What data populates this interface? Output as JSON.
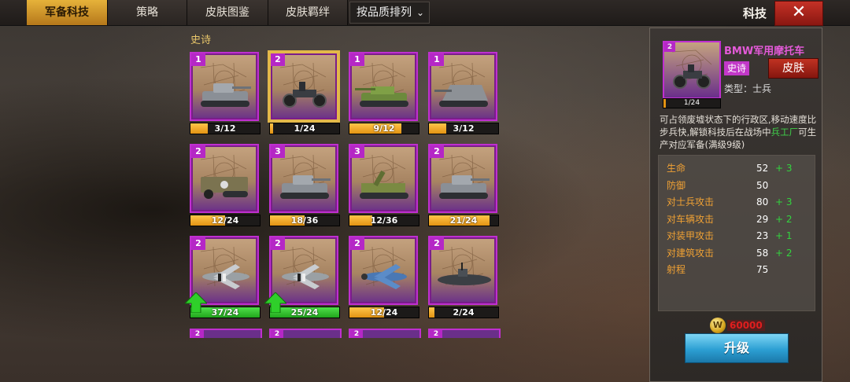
{
  "tabs": [
    {
      "label": "军备科技",
      "active": true
    },
    {
      "label": "策略",
      "active": false
    },
    {
      "label": "皮肤图鉴",
      "active": false
    },
    {
      "label": "皮肤羁绊",
      "active": false
    }
  ],
  "sort": {
    "label": "按品质排列"
  },
  "page_title": "科技",
  "section_label": "史诗",
  "cards": [
    {
      "level": "1",
      "progress": "3/12",
      "fill": 0.25,
      "unit": "tank"
    },
    {
      "level": "2",
      "progress": "1/24",
      "fill": 0.04,
      "unit": "motorcycle",
      "selected": true
    },
    {
      "level": "1",
      "progress": "9/12",
      "fill": 0.75,
      "unit": "tank-destroyer"
    },
    {
      "level": "1",
      "progress": "3/12",
      "fill": 0.25,
      "unit": "assault-gun"
    },
    {
      "level": "2",
      "progress": "12/24",
      "fill": 0.5,
      "unit": "halftrack"
    },
    {
      "level": "3",
      "progress": "18/36",
      "fill": 0.5,
      "unit": "tank"
    },
    {
      "level": "3",
      "progress": "12/36",
      "fill": 0.33,
      "unit": "artillery"
    },
    {
      "level": "2",
      "progress": "21/24",
      "fill": 0.875,
      "unit": "tank"
    },
    {
      "level": "2",
      "progress": "37/24",
      "fill": 1,
      "unit": "plane",
      "upgrade": true
    },
    {
      "level": "2",
      "progress": "25/24",
      "fill": 1,
      "unit": "plane",
      "upgrade": true
    },
    {
      "level": "2",
      "progress": "12/24",
      "fill": 0.5,
      "unit": "blue-plane"
    },
    {
      "level": "2",
      "progress": "2/24",
      "fill": 0.08,
      "unit": "submarine"
    }
  ],
  "partial_cards": [
    {
      "level": "2"
    },
    {
      "level": "2"
    },
    {
      "level": "2"
    },
    {
      "level": "2"
    }
  ],
  "detail": {
    "level": "2",
    "name": "BMW军用摩托车",
    "rarity": "史诗",
    "skin_button": "皮肤",
    "type": "类型：士兵",
    "progress": "1/24",
    "desc_before": "可占领废墟状态下的行政区,移动速度比步兵快,解锁科技后在战场中",
    "desc_highlight": "兵工厂",
    "desc_after": "可生产对应军备(满级9级)",
    "stats": [
      {
        "name": "生命",
        "value": "52",
        "bonus": "+ 3"
      },
      {
        "name": "防御",
        "value": "50",
        "bonus": ""
      },
      {
        "name": "对士兵攻击",
        "value": "80",
        "bonus": "+ 3"
      },
      {
        "name": "对车辆攻击",
        "value": "29",
        "bonus": "+ 2"
      },
      {
        "name": "对装甲攻击",
        "value": "23",
        "bonus": "+ 1"
      },
      {
        "name": "对建筑攻击",
        "value": "58",
        "bonus": "+ 2"
      },
      {
        "name": "射程",
        "value": "75",
        "bonus": ""
      }
    ],
    "coin_symbol": "W",
    "cost": "60000",
    "upgrade_label": "升级"
  },
  "colors": {
    "accent": "#e6b23a",
    "epic": "#c02fd0",
    "bonus": "#33d43f",
    "stat_name": "#f0a134"
  }
}
